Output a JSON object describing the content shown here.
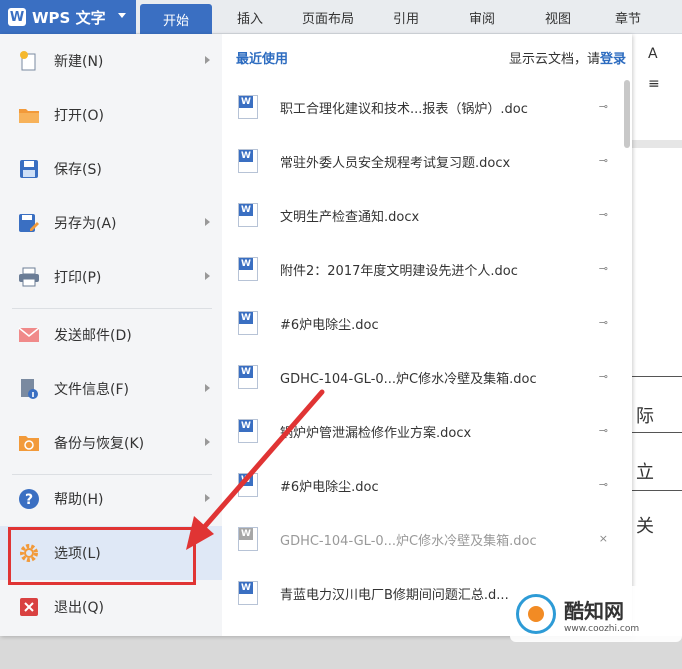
{
  "app": {
    "name": "WPS 文字",
    "logo": "W"
  },
  "tabs": [
    "开始",
    "插入",
    "页面布局",
    "引用",
    "审阅",
    "视图",
    "章节"
  ],
  "menu": [
    {
      "label": "新建(N)",
      "icon": "new-file-icon",
      "submenu": true
    },
    {
      "label": "打开(O)",
      "icon": "folder-icon",
      "submenu": false
    },
    {
      "label": "保存(S)",
      "icon": "save-icon",
      "submenu": false
    },
    {
      "label": "另存为(A)",
      "icon": "save-as-icon",
      "submenu": true
    },
    {
      "label": "打印(P)",
      "icon": "printer-icon",
      "submenu": true
    },
    {
      "label": "发送邮件(D)",
      "icon": "mail-icon",
      "submenu": false
    },
    {
      "label": "文件信息(F)",
      "icon": "file-info-icon",
      "submenu": true
    },
    {
      "label": "备份与恢复(K)",
      "icon": "backup-icon",
      "submenu": true
    },
    {
      "label": "帮助(H)",
      "icon": "help-icon",
      "submenu": true
    },
    {
      "label": "选项(L)",
      "icon": "gear-icon",
      "submenu": false
    },
    {
      "label": "退出(Q)",
      "icon": "exit-icon",
      "submenu": false
    }
  ],
  "recent": {
    "title": "最近使用",
    "cloud_text": "显示云文档，请",
    "cloud_link": "登录",
    "files": [
      {
        "name": "职工合理化建议和技术...报表（锅炉）.doc",
        "available": true
      },
      {
        "name": "常驻外委人员安全规程考试复习题.docx",
        "available": true
      },
      {
        "name": "文明生产检查通知.docx",
        "available": true
      },
      {
        "name": "附件2：2017年度文明建设先进个人.doc",
        "available": true
      },
      {
        "name": "#6炉电除尘.doc",
        "available": true
      },
      {
        "name": "GDHC-104-GL-0...炉C修水冷壁及集箱.doc",
        "available": true
      },
      {
        "name": "锅炉炉管泄漏检修作业方案.docx",
        "available": true
      },
      {
        "name": "#6炉电除尘.doc",
        "available": true
      },
      {
        "name": "GDHC-104-GL-0...炉C修水冷壁及集箱.doc",
        "available": false
      },
      {
        "name": "青蓝电力汉川电厂B修期间问题汇总.d...",
        "available": true
      }
    ]
  },
  "document_chars": [
    "际",
    "立",
    "关"
  ],
  "ribbon_glyphs": [
    "A",
    "≡"
  ],
  "watermark": {
    "title": "酷知网",
    "url": "www.coozhi.com"
  },
  "colors": {
    "accent": "#3a6fc2",
    "highlight": "#e03434"
  }
}
